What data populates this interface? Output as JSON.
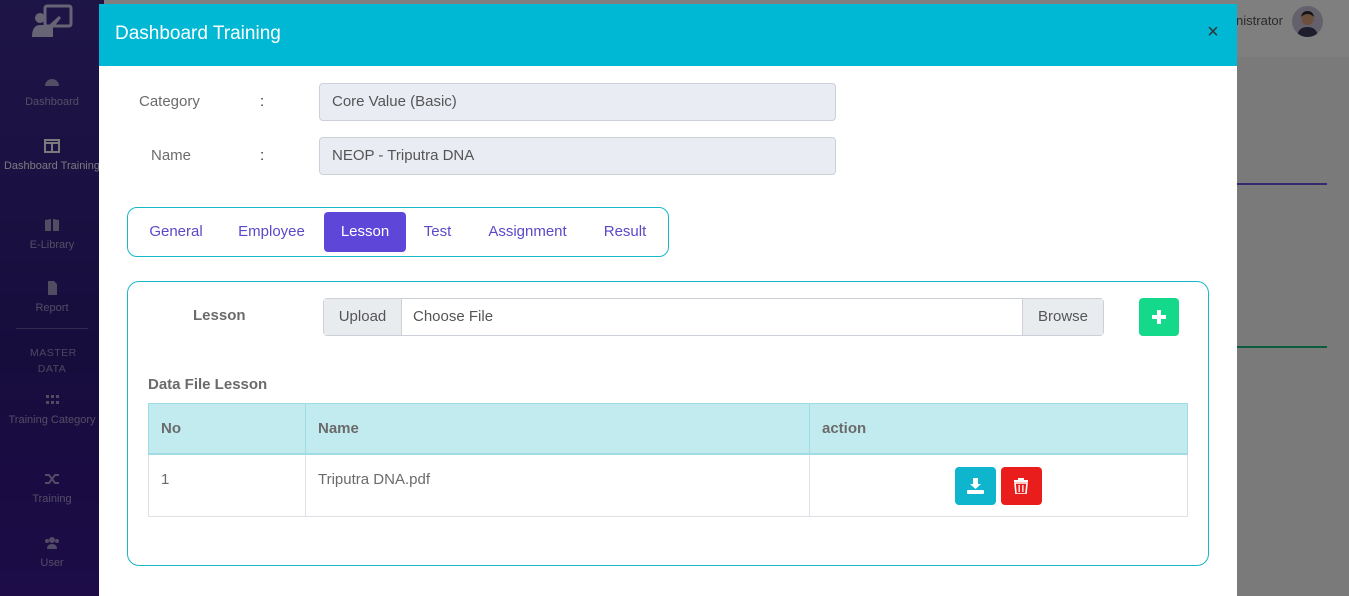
{
  "sidebar": {
    "items": [
      {
        "label": "Dashboard",
        "icon": "gauge-icon"
      },
      {
        "label": "Dashboard Training",
        "icon": "columns-icon"
      },
      {
        "label": "E-Library",
        "icon": "book-icon"
      },
      {
        "label": "Report",
        "icon": "file-icon"
      },
      {
        "label": "Training Category",
        "icon": "grid-icon"
      },
      {
        "label": "Training",
        "icon": "shuffle-icon"
      },
      {
        "label": "User",
        "icon": "users-icon"
      }
    ],
    "section_label": "MASTER DATA"
  },
  "header": {
    "user_name_partial": "nistrator"
  },
  "modal": {
    "title": "Dashboard Training",
    "close_symbol": "×",
    "fields": {
      "category": {
        "label": "Category",
        "colon": ":",
        "value": "Core Value (Basic)"
      },
      "name": {
        "label": "Name",
        "colon": ":",
        "value": "NEOP - Triputra DNA"
      }
    },
    "tabs": [
      {
        "label": "General",
        "active": false
      },
      {
        "label": "Employee",
        "active": false
      },
      {
        "label": "Lesson",
        "active": true
      },
      {
        "label": "Test",
        "active": false
      },
      {
        "label": "Assignment",
        "active": false
      },
      {
        "label": "Result",
        "active": false
      }
    ],
    "lesson": {
      "label": "Lesson",
      "upload_label": "Upload",
      "file_placeholder": "Choose File",
      "browse_label": "Browse",
      "add_icon": "plus-icon"
    },
    "table": {
      "title": "Data File Lesson",
      "columns": [
        "No",
        "Name",
        "action"
      ],
      "rows": [
        {
          "no": "1",
          "name": "Triputra DNA.pdf"
        }
      ]
    }
  },
  "colors": {
    "modal_header": "#00b7d4",
    "tab_active": "#5d46d8",
    "add_button": "#14d98b",
    "download_button": "#0fb5cc",
    "delete_button": "#ea1d1d",
    "sidebar": "#3d2a8e"
  }
}
